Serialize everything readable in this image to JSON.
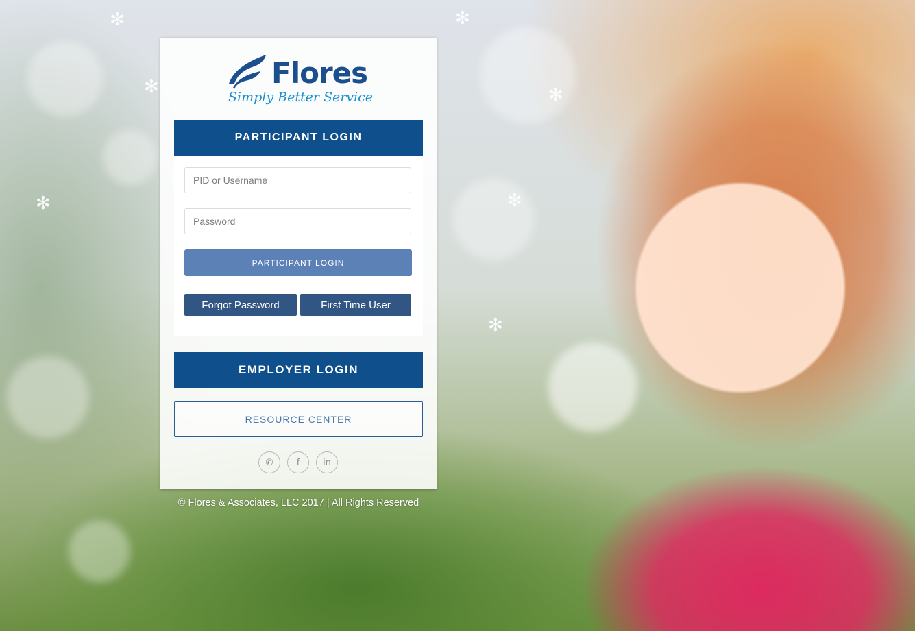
{
  "brand": {
    "name": "Flores",
    "tagline": "Simply Better Service",
    "colors": {
      "navy": "#0f4f8b",
      "mid_blue": "#5b81b6",
      "dark_button": "#325684",
      "sky": "#1d8fcf"
    }
  },
  "participant": {
    "header": "PARTICIPANT LOGIN",
    "username_placeholder": "PID or Username",
    "password_placeholder": "Password",
    "login_button": "PARTICIPANT LOGIN",
    "forgot_button": "Forgot Password",
    "first_time_button": "First Time User"
  },
  "employer": {
    "header": "EMPLOYER LOGIN"
  },
  "resource": {
    "label": "RESOURCE CENTER"
  },
  "social": {
    "icons": [
      "phone-icon",
      "facebook-icon",
      "linkedin-icon"
    ],
    "phone_glyph": "✆",
    "facebook_glyph": "f",
    "linkedin_glyph": "in"
  },
  "footer": {
    "text": "© Flores & Associates, LLC 2017 | All Rights Reserved"
  }
}
